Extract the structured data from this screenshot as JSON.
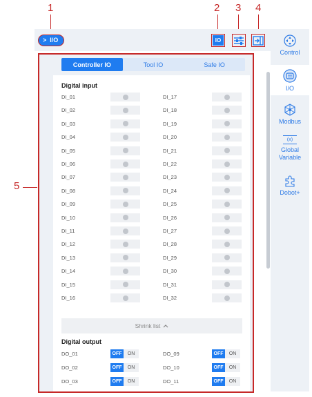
{
  "annotations": [
    "1",
    "2",
    "3",
    "4",
    "5"
  ],
  "breadcrumb": {
    "chevron": ">",
    "label": "I/O"
  },
  "toolbar": {
    "io_label": "IO"
  },
  "tabs": [
    "Controller IO",
    "Tool IO",
    "Safe IO"
  ],
  "digital_input": {
    "title": "Digital input",
    "left": [
      "DI_01",
      "DI_02",
      "DI_03",
      "DI_04",
      "DI_05",
      "DI_06",
      "DI_07",
      "DI_08",
      "DI_09",
      "DI_10",
      "DI_11",
      "DI_12",
      "DI_13",
      "DI_14",
      "DI_15",
      "DI_16"
    ],
    "right": [
      "DI_17",
      "DI_18",
      "DI_19",
      "DI_20",
      "DI_21",
      "DI_22",
      "DI_23",
      "DI_24",
      "DI_25",
      "DI_26",
      "DI_27",
      "DI_28",
      "DI_29",
      "DI_30",
      "DI_31",
      "DI_32"
    ]
  },
  "shrink_label": "Shrink list",
  "digital_output": {
    "title": "Digital output",
    "off_label": "OFF",
    "on_label": "ON",
    "left": [
      "DO_01",
      "DO_02",
      "DO_03"
    ],
    "right": [
      "DO_09",
      "DO_10",
      "DO_11"
    ]
  },
  "sidebar": {
    "control": "Control",
    "io": "I/O",
    "modbus": "Modbus",
    "global_line1": "Global",
    "global_line2": "Variable",
    "global_icon_text": "(x)",
    "dobot": "Dobot+"
  },
  "colors": {
    "accent": "#1f7cf0",
    "annotation": "#c62828",
    "panel_bg": "#edf1f6"
  }
}
